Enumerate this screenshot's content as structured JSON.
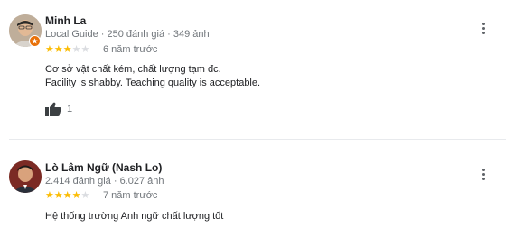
{
  "reviews": [
    {
      "author": "Minh La",
      "meta": "Local Guide · 250 đánh giá · 349 ảnh",
      "rating": 3,
      "max_rating": 5,
      "date": "6 năm trước",
      "text_lines": [
        "Cơ sở vật chất kém, chất lượng tạm đc.",
        "Facility is shabby. Teaching quality is acceptable."
      ],
      "likes": "1",
      "icons": {
        "badge": "local-guide-badge-icon",
        "like": "thumbs-up-icon",
        "menu": "more-vert-icon"
      }
    },
    {
      "author": "Lò Lâm Ngữ (Nash Lo)",
      "meta": "2.414 đánh giá · 6.027 ảnh",
      "rating": 4,
      "max_rating": 5,
      "date": "7 năm trước",
      "text_lines": [
        "Hệ thống trường Anh ngữ chất lượng tốt"
      ],
      "icons": {
        "menu": "more-vert-icon"
      }
    }
  ],
  "colors": {
    "star_on": "#fbbc04",
    "star_off": "#dadce0",
    "badge": "#e8710a",
    "meta_text": "#70757a"
  }
}
